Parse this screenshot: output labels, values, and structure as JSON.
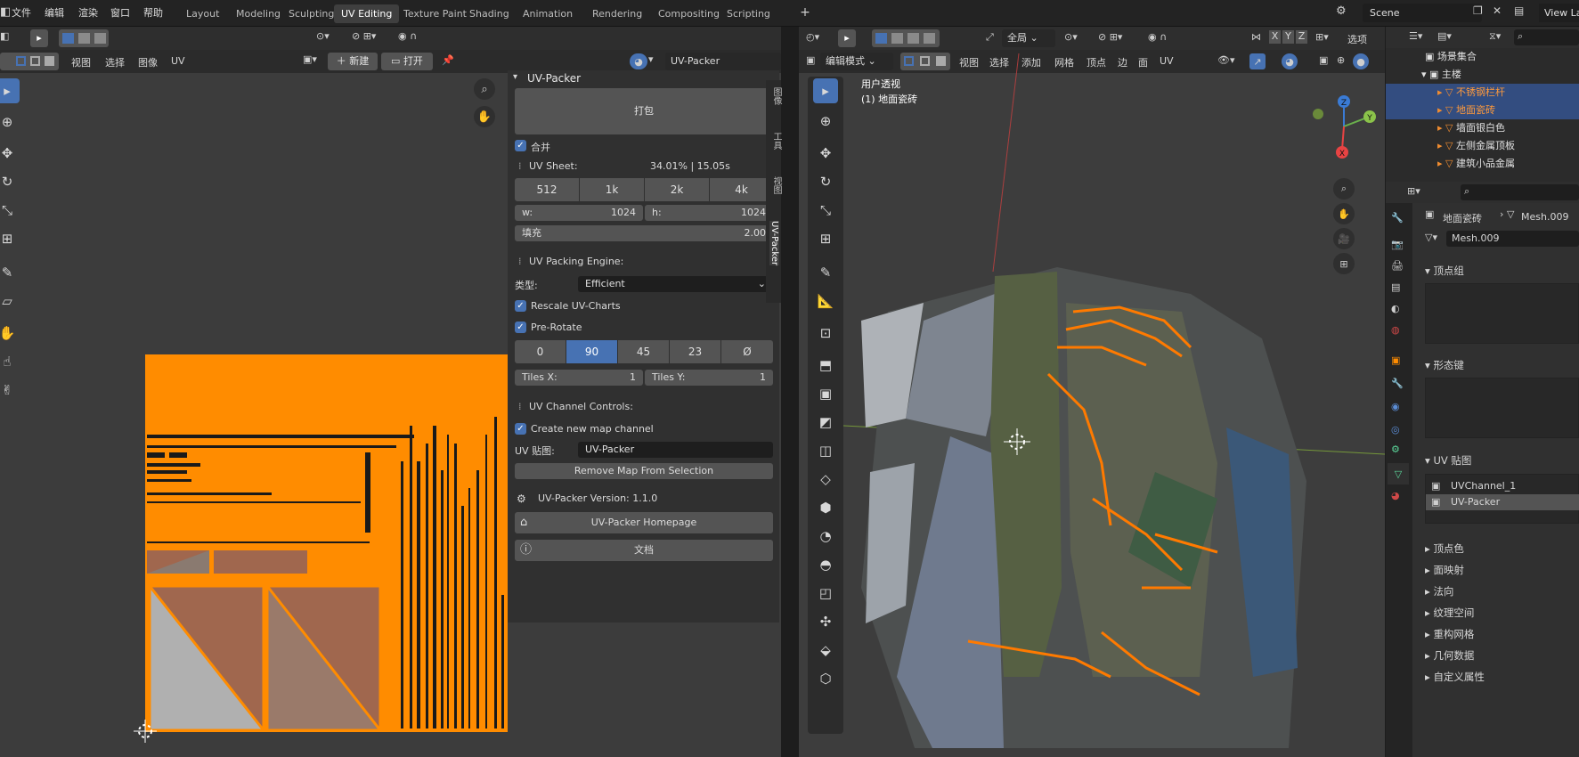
{
  "top_menu": {
    "file": "文件",
    "edit": "编辑",
    "render": "渲染",
    "window": "窗口",
    "help": "帮助"
  },
  "workspaces": [
    "Layout",
    "Modeling",
    "Sculpting",
    "UV Editing",
    "Texture Paint",
    "Shading",
    "Animation",
    "Rendering",
    "Compositing",
    "Scripting"
  ],
  "workspace_add": "+",
  "scene": {
    "name": "Scene",
    "view_layer": "View La"
  },
  "uv_header": {
    "view": "视图",
    "select": "选择",
    "image": "图像",
    "uv": "UV",
    "new": "新建",
    "open": "打开",
    "image_name": "UV-Packer"
  },
  "packer": {
    "title": "UV-Packer",
    "pack_button": "打包",
    "combine": "合并",
    "sheet_label": "UV Sheet:",
    "sheet_stats": "34.01% | 15.05s",
    "sizes": [
      "512",
      "1k",
      "2k",
      "4k"
    ],
    "w_label": "w:",
    "w_value": "1024",
    "h_label": "h:",
    "h_value": "1024",
    "padding_label": "填充",
    "padding_value": "2.00",
    "engine_label": "UV Packing Engine:",
    "type_label": "类型:",
    "type_value": "Efficient",
    "rescale": "Rescale UV-Charts",
    "prerotate": "Pre-Rotate",
    "rotations": [
      "0",
      "90",
      "45",
      "23",
      "Ø"
    ],
    "rotation_selected": "90",
    "tiles_x_label": "Tiles X:",
    "tiles_x": "1",
    "tiles_y_label": "Tiles Y:",
    "tiles_y": "1",
    "channel_label": "UV Channel Controls:",
    "create_channel": "Create new map channel",
    "uvmap_label": "UV 贴图:",
    "uvmap_value": "UV-Packer",
    "remove_btn": "Remove Map From Selection",
    "version": "UV-Packer Version: 1.1.0",
    "homepage": "UV-Packer Homepage",
    "docs": "文档"
  },
  "side_tabs": [
    "图像",
    "工具",
    "视图",
    "UV-Packer"
  ],
  "viewport": {
    "mode": "编辑模式",
    "view": "视图",
    "select": "选择",
    "add": "添加",
    "mesh": "网格",
    "vertex": "顶点",
    "edge": "边",
    "face": "面",
    "uv": "UV",
    "transform": "全局",
    "options": "选项",
    "overlay_title": "用户透视",
    "overlay_sub": "(1) 地面瓷砖",
    "axes": {
      "x": "X",
      "y": "Y",
      "z": "Z"
    },
    "xyz": [
      "X",
      "Y",
      "Z"
    ]
  },
  "outliner": {
    "collection": "场景集合",
    "main": "主楼",
    "items": [
      {
        "name": "不锈钢栏杆",
        "selected": true
      },
      {
        "name": "地面瓷砖",
        "selected": true
      },
      {
        "name": "墙面银白色",
        "selected": false
      },
      {
        "name": "左侧金属顶板",
        "selected": false
      },
      {
        "name": "建筑小品金属",
        "selected": false
      }
    ]
  },
  "properties": {
    "object": "地面瓷砖",
    "mesh": "Mesh.009",
    "mesh_field": "Mesh.009",
    "vertex_groups": "顶点组",
    "shape_keys": "形态键",
    "uv_maps": "UV 贴图",
    "uv_list": [
      {
        "name": "UVChannel_1",
        "active": false
      },
      {
        "name": "UV-Packer",
        "active": true
      }
    ],
    "collapsed": [
      "顶点色",
      "面映射",
      "法向",
      "纹理空间",
      "重构网格",
      "几何数据",
      "自定义属性"
    ]
  },
  "colors": {
    "accent": "#4772b3",
    "uv_orange": "#ff8c00",
    "selection_orange": "#f39c12"
  }
}
